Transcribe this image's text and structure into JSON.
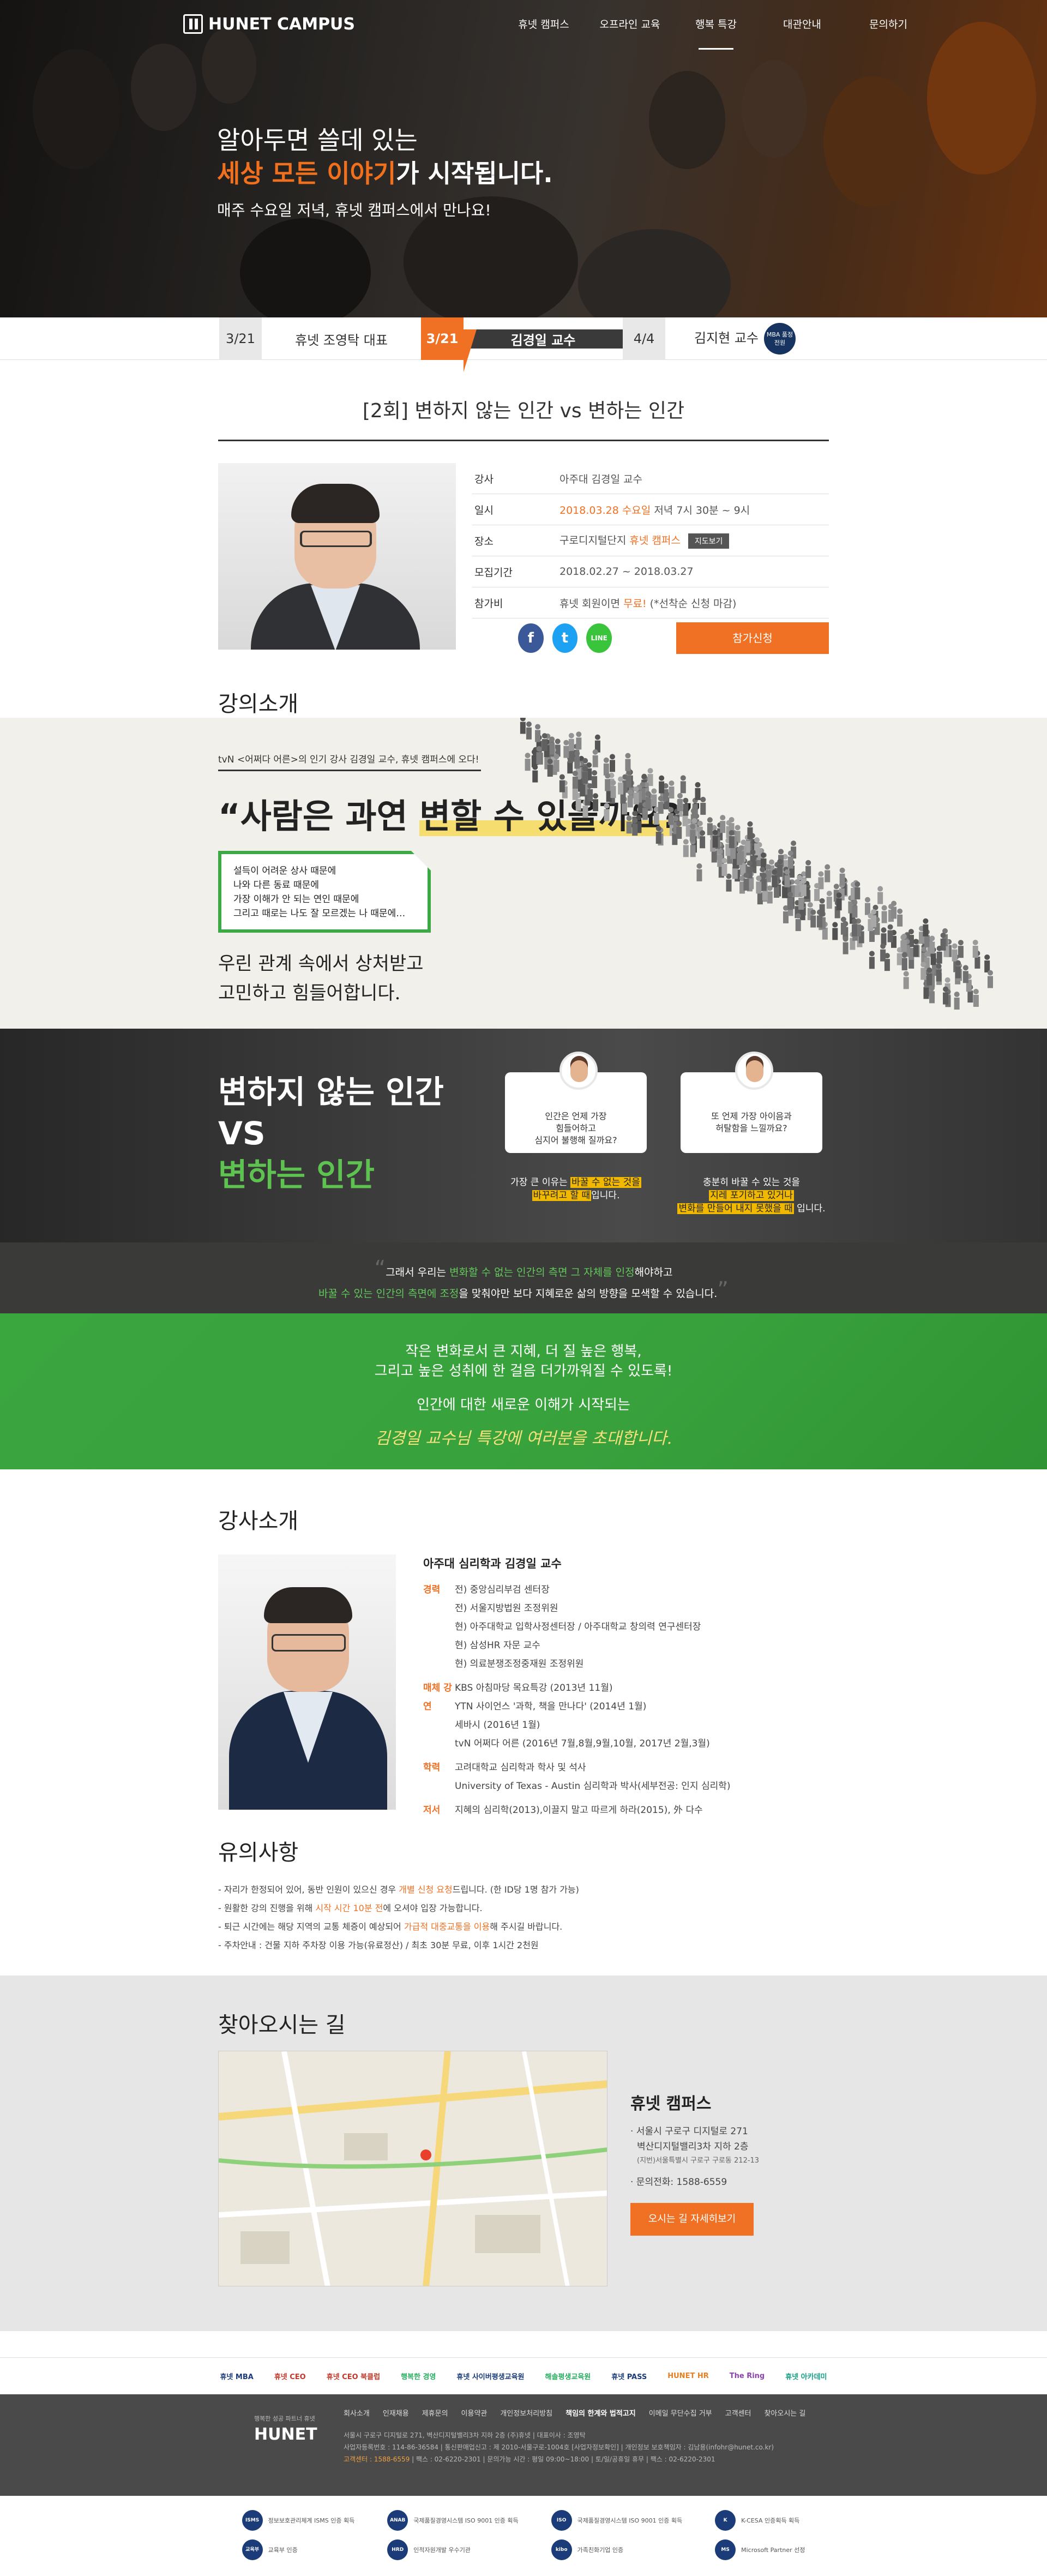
{
  "nav": {
    "logo": "HUNET CAMPUS",
    "items": [
      {
        "label": "휴넷 캠퍼스",
        "active": false
      },
      {
        "label": "오프라인 교육",
        "active": false
      },
      {
        "label": "행복 특강",
        "active": true
      },
      {
        "label": "대관안내",
        "active": false
      },
      {
        "label": "문의하기",
        "active": false
      }
    ]
  },
  "hero": {
    "line1": "알아두면 쓸데 있는",
    "line2_highlight": "세상 모든 이야기",
    "line2_rest": "가 시작됩니다.",
    "line3": "매주 수요일 저녁, 휴넷 캠퍼스에서 만나요!"
  },
  "schedule": [
    {
      "date": "3/21",
      "name": "휴넷 조영탁 대표",
      "active": false
    },
    {
      "date": "3/21",
      "name": "김경일 교수",
      "active": true
    },
    {
      "date": "4/4",
      "name": "김지현 교수",
      "active": false,
      "badge": "MBA 품정전원"
    }
  ],
  "lecture": {
    "title": "[2회] 변하지 않는 인간 vs 변하는 인간",
    "rows": [
      {
        "key": "강사",
        "value": "아주대 김경일 교수"
      },
      {
        "key": "일시",
        "value_orange": "2018.03.28 수요일",
        "value": " 저녁 7시 30분 ~ 9시"
      },
      {
        "key": "장소",
        "value": "구로디지털단지 ",
        "value_orange": "휴넷 캠퍼스",
        "button": "지도보기"
      },
      {
        "key": "모집기간",
        "value": "2018.02.27 ~ 2018.03.27"
      },
      {
        "key": "참가비",
        "value": "휴넷 회원이면 ",
        "value_orange": "무료!",
        "value_tail": " (*선착순 신청 마감)"
      }
    ],
    "share": {
      "facebook": "f",
      "twitter": "t",
      "line": "LINE"
    },
    "apply_label": "참가신청"
  },
  "intro": {
    "section_title": "강의소개",
    "tvn_line": "tvN <어쩌다 어른>의 인기 강사 김경일 교수, 휴넷 캠퍼스에 오다!",
    "big_pre": "“사람은 과연 ",
    "big_hl": "변할 수 있을까요?",
    "big_post": "”",
    "box_lines": [
      "설득이 어려운 상사 때문에",
      "나와 다른 동료 때문에",
      "가장 이해가 안 되는 연인 때문에",
      "그리고 때로는 나도 잘 모르겠는 나 때문에…"
    ],
    "bottom1": "우린 관계 속에서 상처받고",
    "bottom2": "고민하고 힘들어합니다."
  },
  "vs": {
    "line1": "변하지 않는 인간",
    "line2": "VS",
    "line3": "변하는 인간",
    "bubble1": [
      "인간은 언제 가장",
      "힘들어하고",
      "심지어 불행해 질까요?"
    ],
    "bubble2": [
      "또 언제 가장 아이음과",
      "허탈함을 느낄까요?"
    ],
    "cap1_a": "가장 큰 이유는 ",
    "cap1_y": "바꿀 수 없는 것을",
    "cap1_y2": "바꾸려고 할 때",
    "cap1_b": "입니다.",
    "cap2_a": "충분히 바꿀 수 있는 것을",
    "cap2_y": "지레 포기하고 있거나",
    "cap2_y2": "변화를 만들어 내지 못했을 때",
    "cap2_b": " 입니다."
  },
  "quote": {
    "l1a": "그래서 우리는 ",
    "l1g": "변화할 수 없는 인간의 측면 그 자체를 인정",
    "l1b": "해야하고",
    "l2g": "바꿀 수 있는 인간의 측면에 조정",
    "l2b": "을 맞춰야만 보다 지혜로운 삶의 방향을 모색할 수 있습니다."
  },
  "green": {
    "l1": "작은 변화로서 큰 지혜, 더 질 높은 행복,",
    "l2": "그리고 높은 성취에 한 걸음 더가까워질 수 있도록!",
    "l3": "인간에 대한 새로운 이해가 시작되는",
    "l4": "김경일 교수님 특강에 여러분을 초대합니다."
  },
  "speaker": {
    "section_title": "강사소개",
    "name": "아주대 심리학과 김경일 교수",
    "groups": [
      {
        "key": "경력",
        "items": [
          "전) 중앙심리부검 센터장",
          "전) 서울지방법원 조정위원",
          "현) 아주대학교 입학사정센터장 / 아주대학교 창의력 연구센터장",
          "현) 삼성HR 자문 교수",
          "현) 의료분쟁조정중재원 조정위원"
        ]
      },
      {
        "key": "매체 강연",
        "items": [
          "KBS 아침마당 목요특강 (2013년 11월)",
          "YTN 사이언스 '과학, 책을 만나다' (2014년 1월)",
          "세바시 (2016년 1월)",
          "tvN 어쩌다 어른 (2016년 7월,8월,9월,10월, 2017년 2월,3월)"
        ]
      },
      {
        "key": "학력",
        "items": [
          "고려대학교 심리학과 학사 및 석사",
          "University of Texas - Austin 심리학과 박사(세부전공: 인지 심리학)"
        ]
      },
      {
        "key": "저서",
        "items": [
          "지혜의 심리학(2013),이끌지 말고 따르게 하라(2015), 外 다수"
        ]
      }
    ]
  },
  "notes": {
    "section_title": "유의사항",
    "items": [
      {
        "a": "- 자리가 한정되어 있어, 동반 인원이 있으신 경우 ",
        "o": "개별 신청 요청",
        "b": "드립니다. (한 ID당 1명 참가 가능)"
      },
      {
        "a": "- 원활한 강의 진행을 위해 ",
        "o": "시작 시간 10분 전",
        "b": "에 오셔야 입장 가능합니다."
      },
      {
        "a": "- 퇴근 시간에는 해당 지역의 교통 체증이 예상되어 ",
        "o": "가급적 대중교통을 이용",
        "b": "해 주시길 바랍니다."
      },
      {
        "a": "- 주차안내 : 건물 지하 주차장 이용 가능(유료정산) / 최초 30분 무료, 이후 1시간 2천원",
        "o": "",
        "b": ""
      }
    ]
  },
  "directions": {
    "section_title": "찾아오시는 길",
    "place": "휴넷 캠퍼스",
    "addr1": "· 서울시 구로구 디지털로 271",
    "addr2": "벽산디지털밸리3차 지하 2층",
    "addr3": "(지번)서울특별시 구로구 구로동 212-13",
    "phone": "· 문의전화: 1588-6559",
    "button": "오시는 길 자세히보기"
  },
  "partners": [
    "휴넷 MBA",
    "휴넷 CEO",
    "휴넷 CEO 북클럽",
    "행복한 경영",
    "휴넷 사이버평생교육원",
    "해솔평생교육원",
    "휴넷 PASS",
    "HUNET HR",
    "The Ring",
    "휴넷 아카데미"
  ],
  "footer": {
    "sub": "행복한 성공 파트너 휴넷",
    "logo": "HUNET",
    "links": [
      "회사소개",
      "인재채용",
      "제휴문의",
      "이용약관",
      "개인정보처리방침",
      "책임의 한계와 법적고지",
      "이메일 무단수집 거부",
      "고객센터",
      "찾아오시는 길"
    ],
    "text1": "서울시 구로구 디지털로 271, 벽산디지털밸리3차 지하 2층 (주)휴넷 | 대표이사 : 조영탁",
    "text2": "사업자등록번호 : 114-86-36584 | 통신판매업신고 : 제 2010-서울구로-1004호 [사업자정보확인] | 개인정보 보호책임자 : 김남용(infohr@hunet.co.kr)",
    "text3_o": "고객센터 : 1588-6559",
    "text3": " | 팩스 : 02-6220-2301 | 문의가능 시간 : 평일 09:00~18:00 | 토/일/공휴일 휴무 | 팩스 : 02-6220-2301"
  },
  "certs": [
    [
      "정보보호관리체계 ISMS 인증 획득",
      "교육부 인증"
    ],
    [
      "국제품질경영시스템 ISO 9001 인증 획득",
      "인적자원개발 우수기관"
    ],
    [
      "국제품질경영시스템 ISO 9001 인증 획득",
      "가족친화기업 인증"
    ],
    [
      "K-CESA 인증획득 획득",
      "Microsoft Partner 선정"
    ]
  ]
}
